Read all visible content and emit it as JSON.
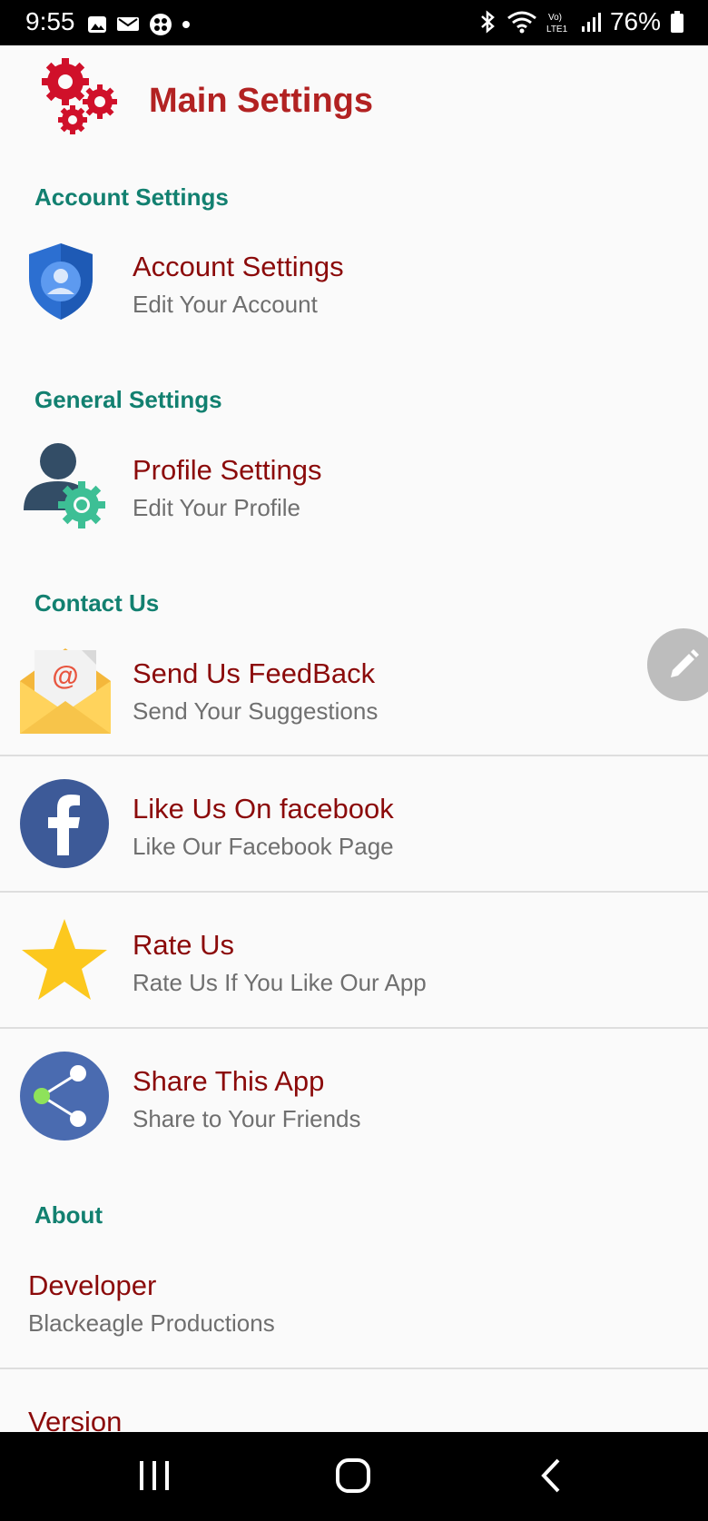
{
  "status_bar": {
    "time": "9:55",
    "battery": "76%"
  },
  "header": {
    "title": "Main Settings",
    "icon": "gears-icon"
  },
  "sections": {
    "account": {
      "title": "Account Settings"
    },
    "general": {
      "title": "General Settings"
    },
    "contact": {
      "title": "Contact Us"
    },
    "about": {
      "title": "About"
    }
  },
  "items": {
    "account_settings": {
      "title": "Account Settings",
      "subtitle": "Edit Your Account",
      "icon": "shield-user-icon"
    },
    "profile_settings": {
      "title": "Profile Settings",
      "subtitle": "Edit Your Profile",
      "icon": "user-gear-icon"
    },
    "feedback": {
      "title": "Send Us FeedBack",
      "subtitle": "Send Your Suggestions",
      "icon": "mail-icon"
    },
    "facebook": {
      "title": "Like Us On facebook",
      "subtitle": "Like Our Facebook Page",
      "icon": "facebook-icon"
    },
    "rate": {
      "title": "Rate Us",
      "subtitle": "Rate Us If You Like Our App",
      "icon": "star-icon"
    },
    "share": {
      "title": "Share This App",
      "subtitle": "Share to Your Friends",
      "icon": "share-icon"
    },
    "developer": {
      "title": "Developer",
      "subtitle": "Blackeagle Productions"
    },
    "version": {
      "title": "Version"
    }
  },
  "colors": {
    "accent_red": "#b22222",
    "item_title": "#8b0a0a",
    "section_teal": "#128070",
    "subtitle_gray": "#6f6f6f"
  }
}
